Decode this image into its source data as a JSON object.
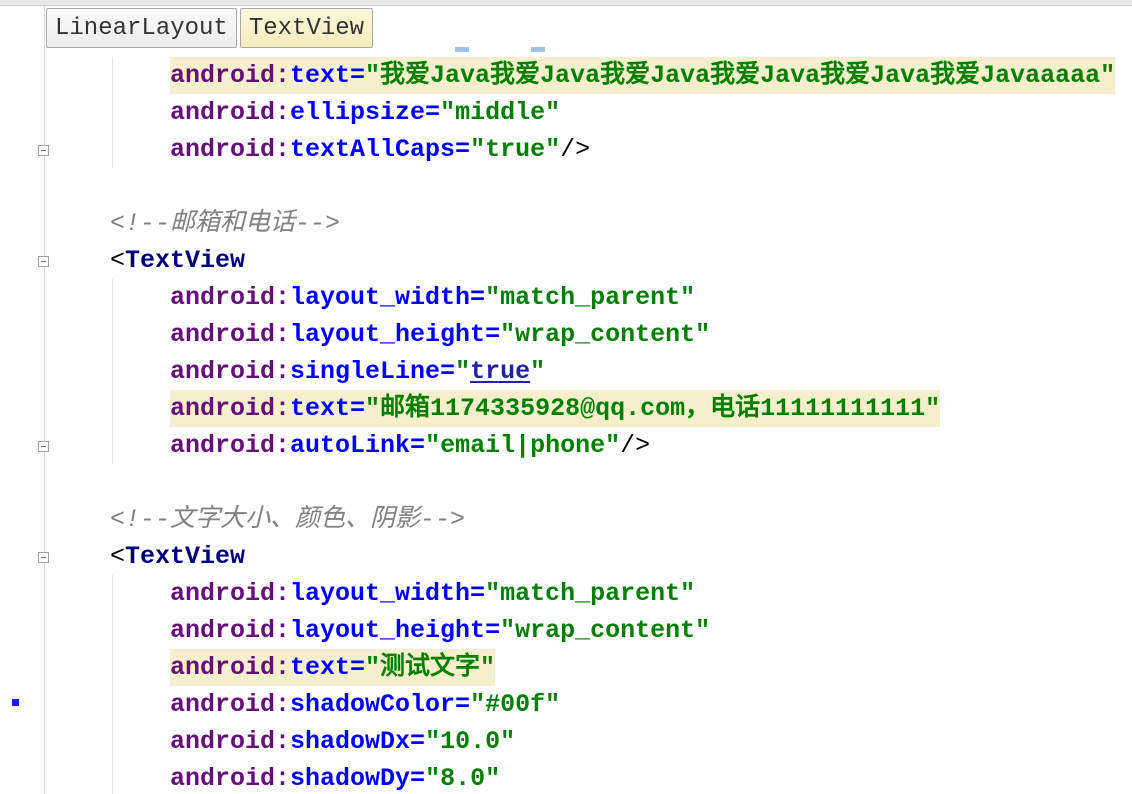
{
  "breadcrumb": [
    {
      "label": "LinearLayout"
    },
    {
      "label": "TextView"
    }
  ],
  "colors": {
    "namespace": "#660e7a",
    "attribute": "#0000ff",
    "value": "#008000",
    "link": "#2121a6",
    "tag": "#000080",
    "comment": "#808080",
    "highlight": "#f6efcd"
  },
  "lines": [
    {
      "highlighted": true,
      "tokens": [
        {
          "t": "ns",
          "v": "android:"
        },
        {
          "t": "attr",
          "v": "text="
        },
        {
          "t": "val",
          "v": "\"我爱Java我爱Java我爱Java我爱Java我爱Java我爱Javaaaaa\""
        }
      ]
    },
    {
      "tokens": [
        {
          "t": "ns",
          "v": "android:"
        },
        {
          "t": "attr",
          "v": "ellipsize="
        },
        {
          "t": "val",
          "v": "\"middle\""
        }
      ]
    },
    {
      "gutter_icon": "fold-end-icon",
      "tokens": [
        {
          "t": "ns",
          "v": "android:"
        },
        {
          "t": "attr",
          "v": "textAllCaps="
        },
        {
          "t": "val",
          "v": "\"true\""
        },
        {
          "t": "punct",
          "v": "/>"
        }
      ]
    },
    {
      "tokens": []
    },
    {
      "tokens": [
        {
          "t": "comment",
          "v": "<!--邮箱和电话-->"
        }
      ]
    },
    {
      "gutter_icon": "fold-start-icon",
      "tokens": [
        {
          "t": "punct",
          "v": "<"
        },
        {
          "t": "tag",
          "v": "TextView"
        }
      ]
    },
    {
      "tokens": [
        {
          "t": "ns",
          "v": "android:"
        },
        {
          "t": "attr",
          "v": "layout_width="
        },
        {
          "t": "val",
          "v": "\"match_parent\""
        }
      ]
    },
    {
      "tokens": [
        {
          "t": "ns",
          "v": "android:"
        },
        {
          "t": "attr",
          "v": "layout_height="
        },
        {
          "t": "val",
          "v": "\"wrap_content\""
        }
      ]
    },
    {
      "tokens": [
        {
          "t": "ns",
          "v": "android:"
        },
        {
          "t": "attr",
          "v": "singleLine="
        },
        {
          "t": "val",
          "v": "\""
        },
        {
          "t": "link",
          "v": "true"
        },
        {
          "t": "val",
          "v": "\""
        }
      ]
    },
    {
      "highlighted": true,
      "tokens": [
        {
          "t": "ns",
          "v": "android:"
        },
        {
          "t": "attr",
          "v": "text="
        },
        {
          "t": "val",
          "v": "\"邮箱1174335928@qq.com，电话11111111111\""
        }
      ]
    },
    {
      "gutter_icon": "fold-end-icon",
      "tokens": [
        {
          "t": "ns",
          "v": "android:"
        },
        {
          "t": "attr",
          "v": "autoLink="
        },
        {
          "t": "val",
          "v": "\"email|phone\""
        },
        {
          "t": "punct",
          "v": "/>"
        }
      ]
    },
    {
      "tokens": []
    },
    {
      "tokens": [
        {
          "t": "comment",
          "v": "<!--文字大小、颜色、阴影-->"
        }
      ]
    },
    {
      "gutter_icon": "fold-start-icon",
      "tokens": [
        {
          "t": "punct",
          "v": "<"
        },
        {
          "t": "tag",
          "v": "TextView"
        }
      ]
    },
    {
      "tokens": [
        {
          "t": "ns",
          "v": "android:"
        },
        {
          "t": "attr",
          "v": "layout_width="
        },
        {
          "t": "val",
          "v": "\"match_parent\""
        }
      ]
    },
    {
      "tokens": [
        {
          "t": "ns",
          "v": "android:"
        },
        {
          "t": "attr",
          "v": "layout_height="
        },
        {
          "t": "val",
          "v": "\"wrap_content\""
        }
      ]
    },
    {
      "highlighted": true,
      "tokens": [
        {
          "t": "ns",
          "v": "android:"
        },
        {
          "t": "attr",
          "v": "text="
        },
        {
          "t": "val",
          "v": "\"测试文字\""
        }
      ]
    },
    {
      "gutter_icon": "modified-marker-icon",
      "tokens": [
        {
          "t": "ns",
          "v": "android:"
        },
        {
          "t": "attr",
          "v": "shadowColor="
        },
        {
          "t": "val",
          "v": "\"#00f\""
        }
      ]
    },
    {
      "tokens": [
        {
          "t": "ns",
          "v": "android:"
        },
        {
          "t": "attr",
          "v": "shadowDx="
        },
        {
          "t": "val",
          "v": "\"10.0\""
        }
      ]
    },
    {
      "tokens": [
        {
          "t": "ns",
          "v": "android:"
        },
        {
          "t": "attr",
          "v": "shadowDy="
        },
        {
          "t": "val",
          "v": "\"8.0\""
        }
      ]
    }
  ]
}
